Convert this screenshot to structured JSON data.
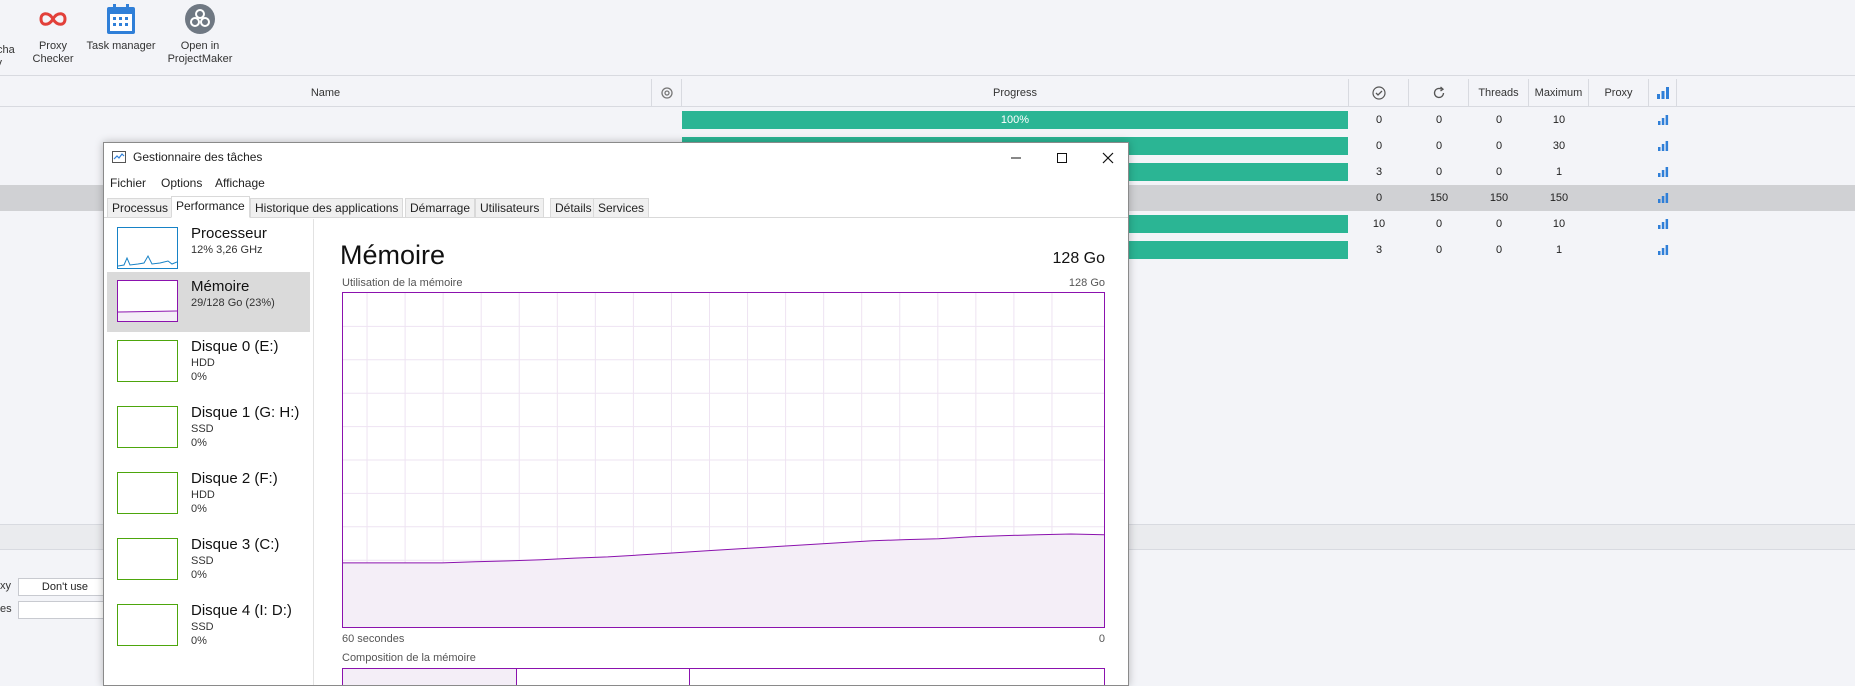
{
  "toolbar": {
    "cut_item_label": "tcha\nly",
    "items": [
      {
        "label": "Proxy\nChecker",
        "icon": "infinity-icon"
      },
      {
        "label": "Task manager",
        "icon": "calendar-icon"
      },
      {
        "label": "Open in\nProjectMaker",
        "icon": "projectmaker-icon"
      }
    ]
  },
  "table": {
    "headers": {
      "name": "Name",
      "settings_icon": "gear-icon",
      "progress": "Progress",
      "success_icon": "check-circle-icon",
      "retry_icon": "refresh-icon",
      "threads": "Threads",
      "maximum": "Maximum",
      "proxy": "Proxy",
      "stats_icon": "bar-chart-icon"
    },
    "rows": [
      {
        "progress_label": "100%",
        "progress": 1.0,
        "success": "0",
        "retry": "0",
        "threads": "0",
        "maximum": "10",
        "selected": false
      },
      {
        "progress_label": "",
        "progress": 1.0,
        "success": "0",
        "retry": "0",
        "threads": "0",
        "maximum": "30",
        "selected": false
      },
      {
        "progress_label": "",
        "progress": 1.0,
        "success": "3",
        "retry": "0",
        "threads": "0",
        "maximum": "1",
        "selected": false
      },
      {
        "progress_label": "",
        "progress": 0,
        "success": "0",
        "retry": "150",
        "threads": "150",
        "maximum": "150",
        "selected": true
      },
      {
        "progress_label": "",
        "progress": 1.0,
        "success": "10",
        "retry": "0",
        "threads": "0",
        "maximum": "10",
        "selected": false
      },
      {
        "progress_label": "",
        "progress": 1.0,
        "success": "3",
        "retry": "0",
        "threads": "0",
        "maximum": "1",
        "selected": false
      }
    ],
    "accent_color": "#2bb594"
  },
  "bottom": {
    "proxy_label_cut": "xy",
    "proxy_value": "Don't use",
    "second_label_cut": "es"
  },
  "task_manager": {
    "title": "Gestionnaire des tâches",
    "menu": [
      "Fichier",
      "Options",
      "Affichage"
    ],
    "tabs": [
      "Processus",
      "Performance",
      "Historique des applications",
      "Démarrage",
      "Utilisateurs",
      "Détails",
      "Services"
    ],
    "active_tab": "Performance",
    "sidebar": [
      {
        "name": "Processeur",
        "line1": "12% 3,26 GHz",
        "line2": "",
        "color": "#1782c6"
      },
      {
        "name": "Mémoire",
        "line1": "29/128 Go (23%)",
        "line2": "",
        "color": "#8b12ae"
      },
      {
        "name": "Disque 0 (E:)",
        "line1": "HDD",
        "line2": "0%",
        "color": "#4da60c"
      },
      {
        "name": "Disque 1 (G: H:)",
        "line1": "SSD",
        "line2": "0%",
        "color": "#4da60c"
      },
      {
        "name": "Disque 2 (F:)",
        "line1": "HDD",
        "line2": "0%",
        "color": "#4da60c"
      },
      {
        "name": "Disque 3 (C:)",
        "line1": "SSD",
        "line2": "0%",
        "color": "#4da60c"
      },
      {
        "name": "Disque 4 (I: D:)",
        "line1": "SSD",
        "line2": "0%",
        "color": "#4da60c"
      }
    ],
    "main": {
      "title": "Mémoire",
      "total": "128 Go",
      "graph_label": "Utilisation de la mémoire",
      "graph_max": "128 Go",
      "graph_span": "60 secondes",
      "graph_min": "0",
      "composition_label": "Composition de la mémoire",
      "usage_percent": 23,
      "color": "#8b12ae"
    }
  }
}
